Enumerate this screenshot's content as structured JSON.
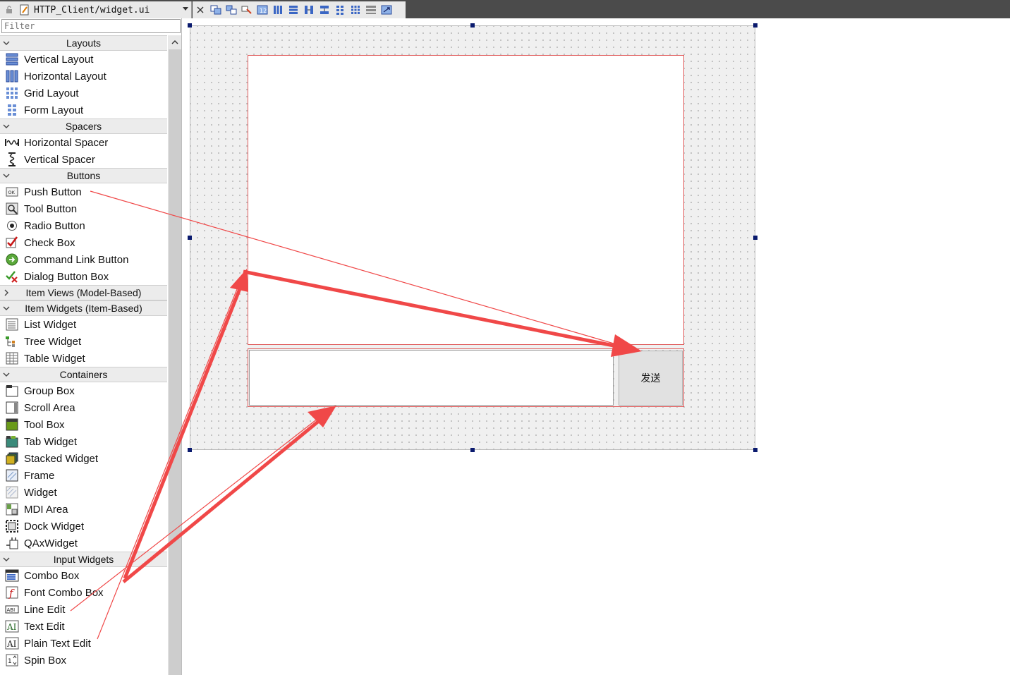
{
  "titlebar": {
    "filename": "HTTP_Client/widget.ui"
  },
  "toolbar": {
    "icons": [
      "close-icon",
      "edit-widgets-icon",
      "edit-signals-icon",
      "edit-buddies-icon",
      "edit-tab-order-icon",
      "layout-horizontal-icon",
      "layout-vertical-icon",
      "layout-h-splitter-icon",
      "layout-v-splitter-icon",
      "layout-form-icon",
      "layout-grid-icon",
      "break-layout-icon",
      "adjust-size-icon"
    ]
  },
  "widgetbox": {
    "filter_placeholder": "Filter",
    "categories": [
      {
        "label": "Layouts",
        "expanded": true,
        "items": [
          "Vertical Layout",
          "Horizontal Layout",
          "Grid Layout",
          "Form Layout"
        ]
      },
      {
        "label": "Spacers",
        "expanded": true,
        "items": [
          "Horizontal Spacer",
          "Vertical Spacer"
        ]
      },
      {
        "label": "Buttons",
        "expanded": true,
        "items": [
          "Push Button",
          "Tool Button",
          "Radio Button",
          "Check Box",
          "Command Link Button",
          "Dialog Button Box"
        ]
      },
      {
        "label": "Item Views (Model-Based)",
        "expanded": false,
        "items": []
      },
      {
        "label": "Item Widgets (Item-Based)",
        "expanded": true,
        "items": [
          "List Widget",
          "Tree Widget",
          "Table Widget"
        ]
      },
      {
        "label": "Containers",
        "expanded": true,
        "items": [
          "Group Box",
          "Scroll Area",
          "Tool Box",
          "Tab Widget",
          "Stacked Widget",
          "Frame",
          "Widget",
          "MDI Area",
          "Dock Widget",
          "QAxWidget"
        ]
      },
      {
        "label": "Input Widgets",
        "expanded": true,
        "items": [
          "Combo Box",
          "Font Combo Box",
          "Line Edit",
          "Text Edit",
          "Plain Text Edit",
          "Spin Box"
        ]
      }
    ]
  },
  "form": {
    "send_button_label": "发送"
  },
  "colors": {
    "annotation_arrow": "#f04848",
    "layout_border": "#e05c5c",
    "handle": "#0a1a6e"
  }
}
